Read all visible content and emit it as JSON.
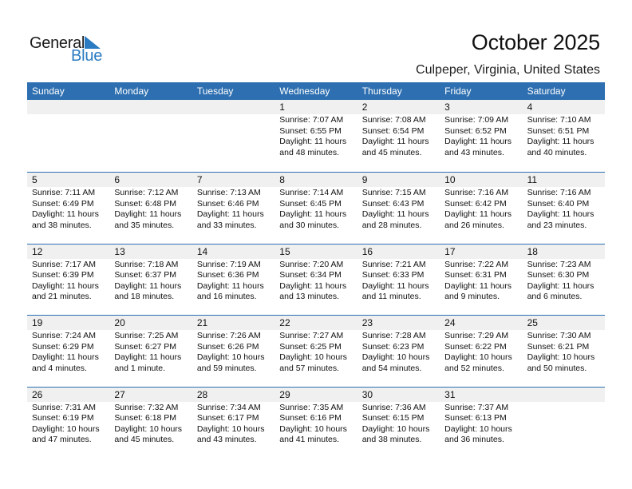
{
  "logo": {
    "word1": "General",
    "word2": "Blue",
    "accent_color": "#2a7bc1",
    "icon": "triangle-flag-icon"
  },
  "header": {
    "title": "October 2025",
    "location": "Culpeper, Virginia, United States"
  },
  "colors": {
    "header_bg": "#2d6fb0",
    "daynum_bg": "#f0f0f0"
  },
  "weekdays": [
    "Sunday",
    "Monday",
    "Tuesday",
    "Wednesday",
    "Thursday",
    "Friday",
    "Saturday"
  ],
  "weeks": [
    [
      null,
      null,
      null,
      {
        "day": "1",
        "sunrise": "Sunrise: 7:07 AM",
        "sunset": "Sunset: 6:55 PM",
        "daylight1": "Daylight: 11 hours",
        "daylight2": "and 48 minutes."
      },
      {
        "day": "2",
        "sunrise": "Sunrise: 7:08 AM",
        "sunset": "Sunset: 6:54 PM",
        "daylight1": "Daylight: 11 hours",
        "daylight2": "and 45 minutes."
      },
      {
        "day": "3",
        "sunrise": "Sunrise: 7:09 AM",
        "sunset": "Sunset: 6:52 PM",
        "daylight1": "Daylight: 11 hours",
        "daylight2": "and 43 minutes."
      },
      {
        "day": "4",
        "sunrise": "Sunrise: 7:10 AM",
        "sunset": "Sunset: 6:51 PM",
        "daylight1": "Daylight: 11 hours",
        "daylight2": "and 40 minutes."
      }
    ],
    [
      {
        "day": "5",
        "sunrise": "Sunrise: 7:11 AM",
        "sunset": "Sunset: 6:49 PM",
        "daylight1": "Daylight: 11 hours",
        "daylight2": "and 38 minutes."
      },
      {
        "day": "6",
        "sunrise": "Sunrise: 7:12 AM",
        "sunset": "Sunset: 6:48 PM",
        "daylight1": "Daylight: 11 hours",
        "daylight2": "and 35 minutes."
      },
      {
        "day": "7",
        "sunrise": "Sunrise: 7:13 AM",
        "sunset": "Sunset: 6:46 PM",
        "daylight1": "Daylight: 11 hours",
        "daylight2": "and 33 minutes."
      },
      {
        "day": "8",
        "sunrise": "Sunrise: 7:14 AM",
        "sunset": "Sunset: 6:45 PM",
        "daylight1": "Daylight: 11 hours",
        "daylight2": "and 30 minutes."
      },
      {
        "day": "9",
        "sunrise": "Sunrise: 7:15 AM",
        "sunset": "Sunset: 6:43 PM",
        "daylight1": "Daylight: 11 hours",
        "daylight2": "and 28 minutes."
      },
      {
        "day": "10",
        "sunrise": "Sunrise: 7:16 AM",
        "sunset": "Sunset: 6:42 PM",
        "daylight1": "Daylight: 11 hours",
        "daylight2": "and 26 minutes."
      },
      {
        "day": "11",
        "sunrise": "Sunrise: 7:16 AM",
        "sunset": "Sunset: 6:40 PM",
        "daylight1": "Daylight: 11 hours",
        "daylight2": "and 23 minutes."
      }
    ],
    [
      {
        "day": "12",
        "sunrise": "Sunrise: 7:17 AM",
        "sunset": "Sunset: 6:39 PM",
        "daylight1": "Daylight: 11 hours",
        "daylight2": "and 21 minutes."
      },
      {
        "day": "13",
        "sunrise": "Sunrise: 7:18 AM",
        "sunset": "Sunset: 6:37 PM",
        "daylight1": "Daylight: 11 hours",
        "daylight2": "and 18 minutes."
      },
      {
        "day": "14",
        "sunrise": "Sunrise: 7:19 AM",
        "sunset": "Sunset: 6:36 PM",
        "daylight1": "Daylight: 11 hours",
        "daylight2": "and 16 minutes."
      },
      {
        "day": "15",
        "sunrise": "Sunrise: 7:20 AM",
        "sunset": "Sunset: 6:34 PM",
        "daylight1": "Daylight: 11 hours",
        "daylight2": "and 13 minutes."
      },
      {
        "day": "16",
        "sunrise": "Sunrise: 7:21 AM",
        "sunset": "Sunset: 6:33 PM",
        "daylight1": "Daylight: 11 hours",
        "daylight2": "and 11 minutes."
      },
      {
        "day": "17",
        "sunrise": "Sunrise: 7:22 AM",
        "sunset": "Sunset: 6:31 PM",
        "daylight1": "Daylight: 11 hours",
        "daylight2": "and 9 minutes."
      },
      {
        "day": "18",
        "sunrise": "Sunrise: 7:23 AM",
        "sunset": "Sunset: 6:30 PM",
        "daylight1": "Daylight: 11 hours",
        "daylight2": "and 6 minutes."
      }
    ],
    [
      {
        "day": "19",
        "sunrise": "Sunrise: 7:24 AM",
        "sunset": "Sunset: 6:29 PM",
        "daylight1": "Daylight: 11 hours",
        "daylight2": "and 4 minutes."
      },
      {
        "day": "20",
        "sunrise": "Sunrise: 7:25 AM",
        "sunset": "Sunset: 6:27 PM",
        "daylight1": "Daylight: 11 hours",
        "daylight2": "and 1 minute."
      },
      {
        "day": "21",
        "sunrise": "Sunrise: 7:26 AM",
        "sunset": "Sunset: 6:26 PM",
        "daylight1": "Daylight: 10 hours",
        "daylight2": "and 59 minutes."
      },
      {
        "day": "22",
        "sunrise": "Sunrise: 7:27 AM",
        "sunset": "Sunset: 6:25 PM",
        "daylight1": "Daylight: 10 hours",
        "daylight2": "and 57 minutes."
      },
      {
        "day": "23",
        "sunrise": "Sunrise: 7:28 AM",
        "sunset": "Sunset: 6:23 PM",
        "daylight1": "Daylight: 10 hours",
        "daylight2": "and 54 minutes."
      },
      {
        "day": "24",
        "sunrise": "Sunrise: 7:29 AM",
        "sunset": "Sunset: 6:22 PM",
        "daylight1": "Daylight: 10 hours",
        "daylight2": "and 52 minutes."
      },
      {
        "day": "25",
        "sunrise": "Sunrise: 7:30 AM",
        "sunset": "Sunset: 6:21 PM",
        "daylight1": "Daylight: 10 hours",
        "daylight2": "and 50 minutes."
      }
    ],
    [
      {
        "day": "26",
        "sunrise": "Sunrise: 7:31 AM",
        "sunset": "Sunset: 6:19 PM",
        "daylight1": "Daylight: 10 hours",
        "daylight2": "and 47 minutes."
      },
      {
        "day": "27",
        "sunrise": "Sunrise: 7:32 AM",
        "sunset": "Sunset: 6:18 PM",
        "daylight1": "Daylight: 10 hours",
        "daylight2": "and 45 minutes."
      },
      {
        "day": "28",
        "sunrise": "Sunrise: 7:34 AM",
        "sunset": "Sunset: 6:17 PM",
        "daylight1": "Daylight: 10 hours",
        "daylight2": "and 43 minutes."
      },
      {
        "day": "29",
        "sunrise": "Sunrise: 7:35 AM",
        "sunset": "Sunset: 6:16 PM",
        "daylight1": "Daylight: 10 hours",
        "daylight2": "and 41 minutes."
      },
      {
        "day": "30",
        "sunrise": "Sunrise: 7:36 AM",
        "sunset": "Sunset: 6:15 PM",
        "daylight1": "Daylight: 10 hours",
        "daylight2": "and 38 minutes."
      },
      {
        "day": "31",
        "sunrise": "Sunrise: 7:37 AM",
        "sunset": "Sunset: 6:13 PM",
        "daylight1": "Daylight: 10 hours",
        "daylight2": "and 36 minutes."
      },
      null
    ]
  ]
}
